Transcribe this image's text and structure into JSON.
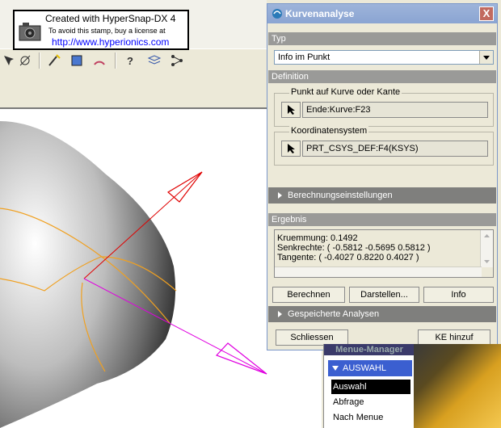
{
  "watermark": {
    "line1": "Created with HyperSnap-DX 4",
    "line2": "To avoid this stamp, buy a license at",
    "line3": "http://www.hyperionics.com"
  },
  "dialog": {
    "title": "Kurvenanalyse",
    "close_label": "X",
    "typ": {
      "header": "Typ",
      "selected": "Info im Punkt"
    },
    "definition": {
      "header": "Definition",
      "point_group_label": "Punkt auf Kurve oder Kante",
      "point_value": "Ende:Kurve:F23",
      "csys_group_label": "Koordinatensystem",
      "csys_value": "PRT_CSYS_DEF:F4(KSYS)"
    },
    "calc_settings_label": "Berechnungseinstellungen",
    "ergebnis": {
      "header": "Ergebnis",
      "lines": [
        "Kruemmung: 0.1492",
        "Senkrechte: ( -0.5812 -0.5695 0.5812 )",
        "Tangente: ( -0.4027 0.8220 0.4027 )"
      ]
    },
    "buttons": {
      "compute": "Berechnen",
      "show": "Darstellen...",
      "info": "Info",
      "close": "Schliessen",
      "add_feature": "KE hinzuf"
    },
    "saved_analyses_label": "Gespeicherte Analysen"
  },
  "menu_manager": {
    "title": "Menue-Manager",
    "header": "AUSWAHL",
    "items": [
      "Auswahl",
      "Abfrage",
      "Nach Menue"
    ]
  },
  "colors": {
    "title_bar": "#8aa4d2",
    "section_header": "#9a9a98",
    "menu_header": "#3b5fd0",
    "curve": "#f0a020",
    "tangent_vector": "#e00000",
    "normal_vector": "#e000e0"
  }
}
